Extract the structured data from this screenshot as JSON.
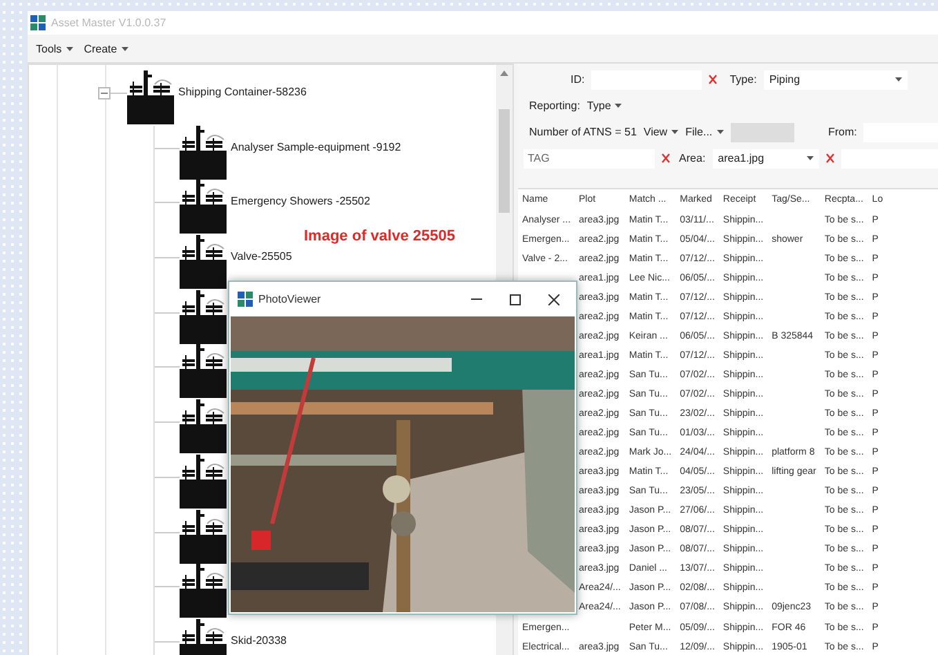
{
  "window": {
    "title": "Asset Master V1.0.0.37"
  },
  "menu": [
    {
      "label": "Tools"
    },
    {
      "label": "Create"
    }
  ],
  "tree": {
    "label": "Shipping Container-58236",
    "expanded": true,
    "children": [
      {
        "kind": "labeled",
        "label": "Analyser Sample-equipment -9192"
      },
      {
        "kind": "labeled",
        "label": "Emergency Showers -25502"
      },
      {
        "kind": "labeled",
        "label": "Valve-25505"
      },
      {
        "kind": "covered"
      },
      {
        "kind": "covered"
      },
      {
        "kind": "covered"
      },
      {
        "kind": "covered"
      },
      {
        "kind": "covered"
      },
      {
        "kind": "covered"
      },
      {
        "kind": "labeled",
        "label": "Skid-20338"
      }
    ]
  },
  "annotation": "Image of valve 25505",
  "photo_viewer": {
    "title": "PhotoViewer"
  },
  "filters": {
    "id_label": "ID:",
    "type_label": "Type:",
    "type_value": "Piping",
    "reporting_label": "Reporting:",
    "reporting_menu": "Type",
    "count": "Number of ATNS = 51",
    "view_menu": "View",
    "file_menu": "File...",
    "from_label": "From:",
    "tag_placeholder": "TAG",
    "area_label": "Area:",
    "area_value": "area1.jpg"
  },
  "table": {
    "columns": [
      "Name",
      "Plot",
      "Match ...",
      "Marked",
      "Receipt",
      "Tag/Se...",
      "Recpta...",
      "Lo"
    ],
    "rows": [
      [
        "Analyser ...",
        "area3.jpg",
        "Matin T...",
        "03/11/...",
        "Shippin...",
        null,
        "To be s...",
        "P"
      ],
      [
        "Emergen...",
        "area2.jpg",
        "Matin T...",
        "05/04/...",
        "Shippin...",
        "shower",
        "To be s...",
        "P"
      ],
      [
        "Valve - 2...",
        "area2.jpg",
        "Matin T...",
        "07/12/...",
        "Shippin...",
        null,
        "To be s...",
        "P"
      ],
      [
        null,
        "area1.jpg",
        "Lee Nic...",
        "06/05/...",
        "Shippin...",
        null,
        "To be s...",
        "P"
      ],
      [
        null,
        "area3.jpg",
        "Matin T...",
        "07/12/...",
        "Shippin...",
        null,
        "To be s...",
        "P"
      ],
      [
        null,
        "area2.jpg",
        "Matin T...",
        "07/12/...",
        "Shippin...",
        null,
        "To be s...",
        "P"
      ],
      [
        null,
        "area2.jpg",
        "Keiran ...",
        "06/05/...",
        "Shippin...",
        "B 325844",
        "To be s...",
        "P"
      ],
      [
        null,
        "area1.jpg",
        "Matin T...",
        "07/12/...",
        "Shippin...",
        null,
        "To be s...",
        "P"
      ],
      [
        null,
        "area2.jpg",
        "San Tu...",
        "07/02/...",
        "Shippin...",
        null,
        "To be s...",
        "P"
      ],
      [
        null,
        "area2.jpg",
        "San Tu...",
        "07/02/...",
        "Shippin...",
        null,
        "To be s...",
        "P"
      ],
      [
        null,
        "area2.jpg",
        "San Tu...",
        "23/02/...",
        "Shippin...",
        null,
        "To be s...",
        "P"
      ],
      [
        null,
        "area2.jpg",
        "San Tu...",
        "01/03/...",
        "Shippin...",
        null,
        "To be s...",
        "P"
      ],
      [
        null,
        "area2.jpg",
        "Mark Jo...",
        "24/04/...",
        "Shippin...",
        "platform 8",
        "To be s...",
        "P"
      ],
      [
        null,
        "area3.jpg",
        "Matin T...",
        "04/05/...",
        "Shippin...",
        "lifting gear",
        "To be s...",
        "P"
      ],
      [
        null,
        "area3.jpg",
        "San Tu...",
        "23/05/...",
        "Shippin...",
        null,
        "To be s...",
        "P"
      ],
      [
        null,
        "area3.jpg",
        "Jason P...",
        "27/06/...",
        "Shippin...",
        null,
        "To be s...",
        "P"
      ],
      [
        null,
        "area3.jpg",
        "Jason P...",
        "08/07/...",
        "Shippin...",
        null,
        "To be s...",
        "P"
      ],
      [
        null,
        "area3.jpg",
        "Jason P...",
        "08/07/...",
        "Shippin...",
        null,
        "To be s...",
        "P"
      ],
      [
        null,
        "area3.jpg",
        "Daniel ...",
        "13/07/...",
        "Shippin...",
        null,
        "To be s...",
        "P"
      ],
      [
        null,
        "Area24/...",
        "Jason P...",
        "02/08/...",
        "Shippin...",
        null,
        "To be s...",
        "P"
      ],
      [
        null,
        "Area24/...",
        "Jason P...",
        "07/08/...",
        "Shippin...",
        "09jenc23",
        "To be s...",
        "P"
      ],
      [
        "Emergen...",
        null,
        "Peter M...",
        "05/09/...",
        "Shippin...",
        "FOR 46",
        "To be s...",
        "P"
      ],
      [
        "Electrical...",
        "area3.jpg",
        "San Tu...",
        "12/09/...",
        "Shippin...",
        "1905-01",
        "To be s...",
        "P"
      ]
    ]
  }
}
